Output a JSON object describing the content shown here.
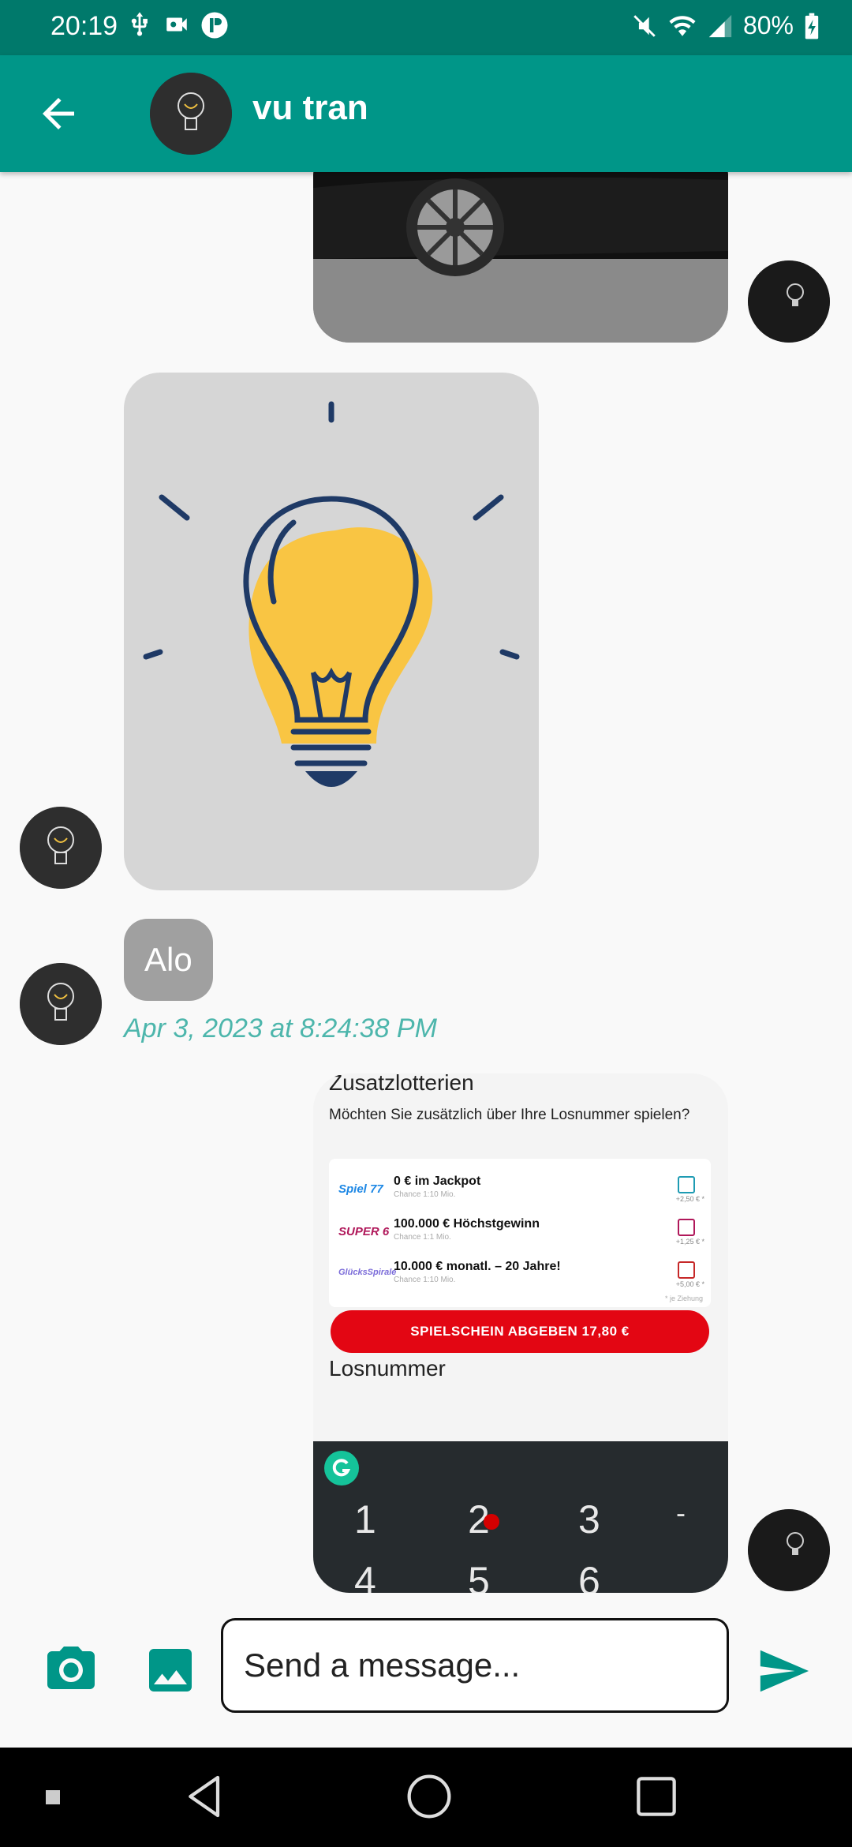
{
  "status_bar": {
    "time": "20:19",
    "battery": "80%"
  },
  "header": {
    "contact_name": "vu tran"
  },
  "messages": {
    "text_message": "Alo",
    "timestamp": "Apr 3, 2023 at 8:24:38 PM"
  },
  "screenshot": {
    "heading": "Zusatzlotterien",
    "question": "Möchten Sie zusätzlich über Ihre Losnummer spielen?",
    "rows": [
      {
        "logo": "Spiel 77",
        "text": "0 € im Jackpot",
        "sub": "Chance 1:10 Mio.",
        "price": "+2,50 € *",
        "logo_color": "#1e88e5",
        "box_color": "#1e9bb3"
      },
      {
        "logo": "SUPER 6",
        "text": "100.000 € Höchstgewinn",
        "sub": "Chance 1:1 Mio.",
        "price": "+1,25 € *",
        "logo_color": "#b0185a",
        "box_color": "#b0185a"
      },
      {
        "logo": "GlücksSpirale",
        "text": "10.000 € monatl. – 20 Jahre!",
        "sub": "Chance 1:10 Mio.",
        "price": "+5,00 € *",
        "logo_color": "#7b6cd9",
        "box_color": "#c62828"
      }
    ],
    "note": "* je Ziehung",
    "button": "SPIELSCHEIN ABGEBEN  17,80 €",
    "section": "Losnummer",
    "keys": [
      "1",
      "2",
      "3",
      "-",
      "4",
      "5",
      "6"
    ]
  },
  "composer": {
    "placeholder": "Send a message..."
  },
  "colors": {
    "primary": "#009688",
    "primary_dark": "#00796b",
    "accent_teal": "#4db6ac",
    "bubble_gray": "#a0a0a0"
  },
  "icons": {
    "back": "arrow-left",
    "camera": "camera",
    "gallery": "image",
    "send": "send"
  }
}
